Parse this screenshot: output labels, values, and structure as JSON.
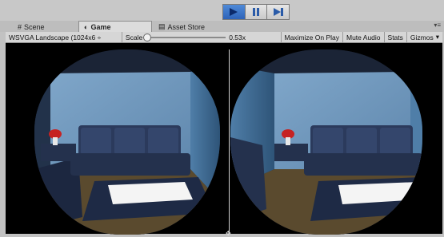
{
  "playbar": {
    "buttons": [
      {
        "name": "play",
        "icon": "play-icon",
        "active": true
      },
      {
        "name": "pause",
        "icon": "pause-icon",
        "active": false
      },
      {
        "name": "step",
        "icon": "step-icon",
        "active": false
      }
    ]
  },
  "tabs": [
    {
      "label": "Scene",
      "icon": "hash-icon",
      "active": false
    },
    {
      "label": "Game",
      "icon": "game-controller-icon",
      "active": true
    },
    {
      "label": "Asset Store",
      "icon": "store-icon",
      "active": false
    }
  ],
  "toolbar": {
    "resolution": "WSVGA Landscape (1024x6 ÷",
    "scale_label": "Scale",
    "scale_value": "0.53x",
    "maximize": "Maximize On Play",
    "mute": "Mute Audio",
    "stats": "Stats",
    "gizmos": "Gizmos"
  },
  "colors": {
    "accent": "#2d63b8",
    "panel": "#c2c2c2"
  }
}
